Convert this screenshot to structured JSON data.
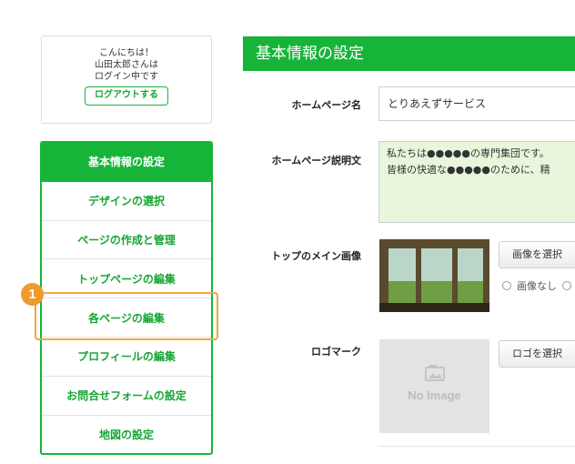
{
  "login": {
    "greeting": "こんにちは！",
    "user": "山田太郎さんは",
    "status": "ログイン中です",
    "logout_label": "ログアウトする"
  },
  "sidebar": {
    "items": [
      {
        "label": "基本情報の設定"
      },
      {
        "label": "デザインの選択"
      },
      {
        "label": "ページの作成と管理"
      },
      {
        "label": "トップページの編集"
      },
      {
        "label": "各ページの編集"
      },
      {
        "label": "プロフィールの編集"
      },
      {
        "label": "お問合せフォームの設定"
      },
      {
        "label": "地図の設定"
      }
    ],
    "active_index": 0,
    "highlighted_index": 4
  },
  "annotation": {
    "badge": "1",
    "color": "#ee9a2d"
  },
  "main": {
    "title": "基本情報の設定",
    "homepage_name": {
      "label": "ホームページ名",
      "value": "とりあえずサービス"
    },
    "homepage_description": {
      "label": "ホームページ説明文",
      "line1": "私たちは●●●●●の専門集団です。",
      "line2": "皆様の快適な●●●●●のために、精"
    },
    "top_image": {
      "label": "トップのメイン画像",
      "select_button": "画像を選択",
      "no_image_option": "画像なし"
    },
    "logo": {
      "label": "ロゴマーク",
      "select_button": "ロゴを選択",
      "placeholder_text": "No Image"
    }
  },
  "colors": {
    "accent_green": "#17b43a",
    "text_green": "#17a534",
    "textarea_bg": "#e8f6dc",
    "highlight_orange": "#f0a640"
  }
}
